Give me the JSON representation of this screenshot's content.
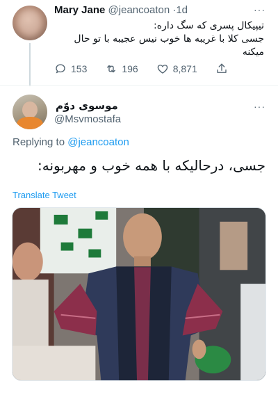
{
  "parent_tweet": {
    "author_name": "Mary Jane",
    "handle": "@jeancoaton",
    "separator": "·",
    "time": "1d",
    "more": "···",
    "text": "تیپیکال پسری که سگ داره:\nجسی کلا با غریبه ها خوب نیس عجیبه با تو حال میکنه",
    "replies": "153",
    "retweets": "196",
    "likes": "8,871"
  },
  "reply_tweet": {
    "author_name": "موسوی دوّم",
    "handle": "@Msvmostafa",
    "more": "···",
    "replying_prefix": "Replying to",
    "replying_to": "@jeancoaton",
    "text": "جسی، درحالیکه با همه خوب و مهربونه:",
    "translate_label": "Translate Tweet"
  },
  "icons": {
    "reply": "reply-icon",
    "retweet": "retweet-icon",
    "like": "heart-icon",
    "share": "share-icon",
    "more": "more-icon"
  },
  "colors": {
    "link": "#1d9bf0",
    "secondary_text": "#536471",
    "primary_text": "#0f1419"
  }
}
